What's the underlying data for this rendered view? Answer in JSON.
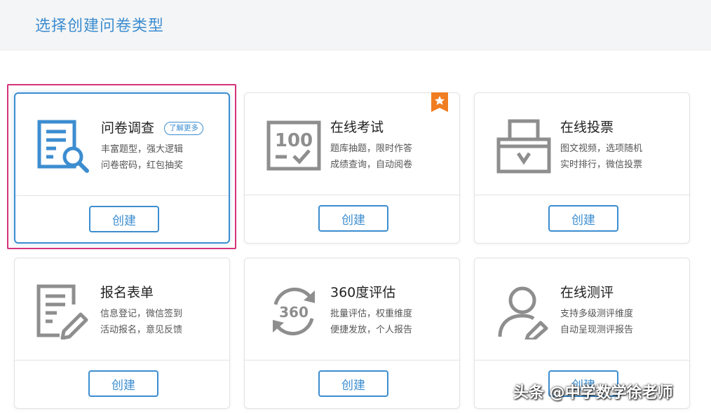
{
  "header": {
    "title": "选择创建问卷类型"
  },
  "colors": {
    "accent": "#3c8dd0",
    "icon_gray": "#8e8e8e",
    "ribbon": "#f07d22",
    "highlight": "#d4337a"
  },
  "cards": [
    {
      "title": "问卷调查",
      "badge": "了解更多",
      "desc1": "丰富题型，强大逻辑",
      "desc2": "问卷密码，红包抽奖",
      "button": "创建",
      "icon": "survey-icon"
    },
    {
      "title": "在线考试",
      "desc1": "题库抽题，限时作答",
      "desc2": "成绩查询，自动阅卷",
      "button": "创建",
      "icon": "exam-100-icon"
    },
    {
      "title": "在线投票",
      "desc1": "图文视频，选项随机",
      "desc2": "实时排行，微信投票",
      "button": "创建",
      "icon": "ballot-box-icon"
    },
    {
      "title": "报名表单",
      "desc1": "信息登记，微信签到",
      "desc2": "活动报名，意见反馈",
      "button": "创建",
      "icon": "form-edit-icon"
    },
    {
      "title": "360度评估",
      "desc1": "批量评估，权重维度",
      "desc2": "便捷发放，个人报告",
      "button": "创建",
      "icon": "refresh-360-icon"
    },
    {
      "title": "在线测评",
      "desc1": "支持多级测评维度",
      "desc2": "自动呈现测评报告",
      "button": "创建",
      "icon": "user-edit-icon"
    }
  ],
  "watermark": "头条 @中学数学徐老师"
}
